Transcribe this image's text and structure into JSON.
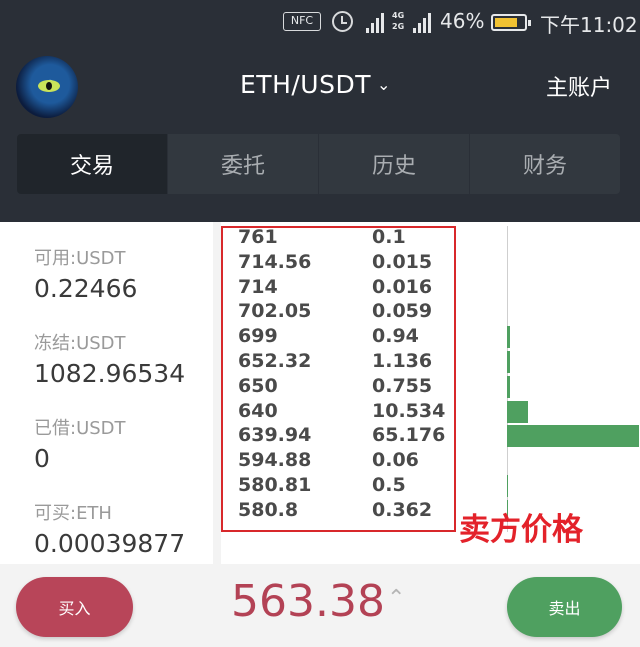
{
  "status_bar": {
    "nfc": "NFC",
    "network": "4G\n2G",
    "battery_pct": "46%",
    "battery_level": 0.46,
    "time": "下午11:02"
  },
  "header": {
    "pair": "ETH/USDT",
    "account": "主账户"
  },
  "tabs": [
    {
      "label": "交易",
      "active": true
    },
    {
      "label": "委托",
      "active": false
    },
    {
      "label": "历史",
      "active": false
    },
    {
      "label": "财务",
      "active": false
    }
  ],
  "balances": [
    {
      "label": "可用:USDT",
      "value": "0.22466"
    },
    {
      "label": "冻结:USDT",
      "value": "1082.96534"
    },
    {
      "label": "已借:USDT",
      "value": "0"
    },
    {
      "label": "可买:ETH",
      "value": "0.00039877"
    }
  ],
  "orderbook": {
    "rows": [
      {
        "price": "761",
        "amount": "0.1"
      },
      {
        "price": "714.56",
        "amount": "0.015"
      },
      {
        "price": "714",
        "amount": "0.016"
      },
      {
        "price": "702.05",
        "amount": "0.059"
      },
      {
        "price": "699",
        "amount": "0.94"
      },
      {
        "price": "652.32",
        "amount": "1.136"
      },
      {
        "price": "650",
        "amount": "0.755"
      },
      {
        "price": "640",
        "amount": "10.534"
      },
      {
        "price": "639.94",
        "amount": "65.176"
      },
      {
        "price": "594.88",
        "amount": "0.06"
      },
      {
        "price": "580.81",
        "amount": "0.5"
      },
      {
        "price": "580.8",
        "amount": "0.362"
      }
    ],
    "annotation": "卖方价格",
    "max_amount": 65.176
  },
  "bottom": {
    "buy_label": "买入",
    "sell_label": "卖出",
    "last_price": "563.38"
  },
  "colors": {
    "dark_bg": "#2a2f37",
    "buy": "#b84559",
    "sell": "#4fa060",
    "price_red": "#b34255",
    "annotation_red": "#e3222a"
  }
}
